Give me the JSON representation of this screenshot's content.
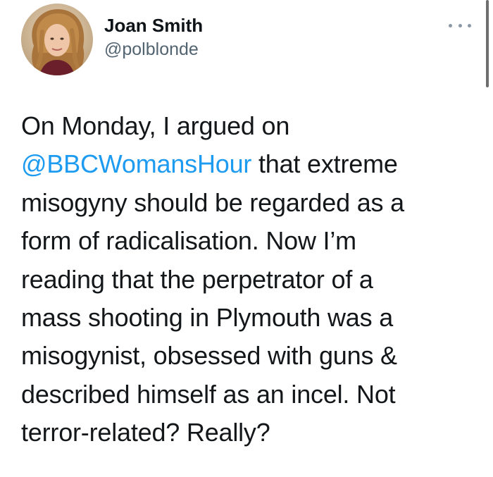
{
  "author": {
    "display_name": "Joan Smith",
    "handle": "@polblonde"
  },
  "tweet": {
    "lines": [
      {
        "text": "On Monday, I argued on"
      },
      {
        "mention": "@BBCWomansHour",
        "text": " that extreme"
      },
      {
        "text": "misogyny should be regarded as a"
      },
      {
        "text": "form of radicalisation. Now I’m"
      },
      {
        "text": "reading that the perpetrator of a"
      },
      {
        "text": "mass shooting in Plymouth was a"
      },
      {
        "text": "misogynist, obsessed with guns &"
      },
      {
        "text": "described himself as an incel. Not"
      },
      {
        "text": "terror-related? Really?"
      }
    ]
  },
  "icons": {
    "more": "more-options-icon",
    "avatar": "profile-photo"
  },
  "colors": {
    "mention": "#1d9bf0",
    "handle": "#536471",
    "text": "#14171a"
  }
}
